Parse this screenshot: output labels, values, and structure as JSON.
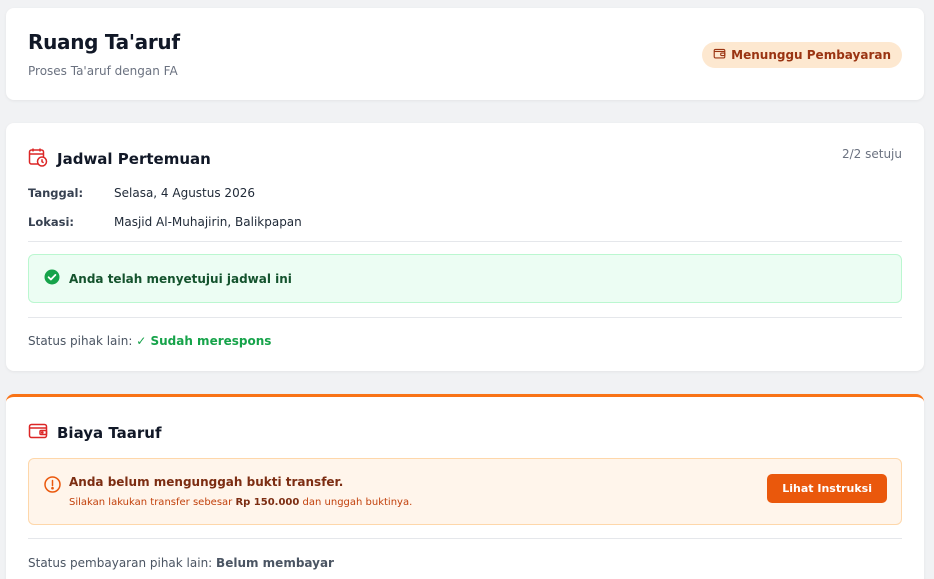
{
  "header": {
    "title": "Ruang Ta'aruf",
    "subtitle": "Proses Ta'aruf dengan FA",
    "status_badge": "Menunggu Pembayaran"
  },
  "schedule": {
    "title": "Jadwal Pertemuan",
    "agree_count": "2/2 setuju",
    "date_label": "Tanggal:",
    "date_value": "Selasa, 4 Agustus 2026",
    "location_label": "Lokasi:",
    "location_value": "Masjid Al-Muhajirin, Balikpapan",
    "approval_message": "Anda telah menyetujui jadwal ini",
    "other_status_label": "Status pihak lain:",
    "other_status_value": "✓ Sudah merespons"
  },
  "fee": {
    "title": "Biaya Taaruf",
    "warning_title": "Anda belum mengunggah bukti transfer.",
    "warning_desc_prefix": "Silakan lakukan transfer sebesar",
    "warning_amount": "Rp 150.000",
    "warning_desc_suffix": "dan unggah buktinya.",
    "instructions_button": "Lihat Instruksi",
    "payment_status_label": "Status pembayaran pihak lain:",
    "payment_status_value": "Belum membayar"
  },
  "icons": {
    "badge": "wallet-icon",
    "schedule": "calendar-clock-icon",
    "approval": "check-circle-icon",
    "fee": "wallet-icon",
    "warning": "alert-circle-icon"
  },
  "colors": {
    "accent_orange": "#ea580c",
    "success_green": "#16a34a",
    "badge_bg": "#fde8d0",
    "schedule_icon_red": "#dc2626"
  }
}
